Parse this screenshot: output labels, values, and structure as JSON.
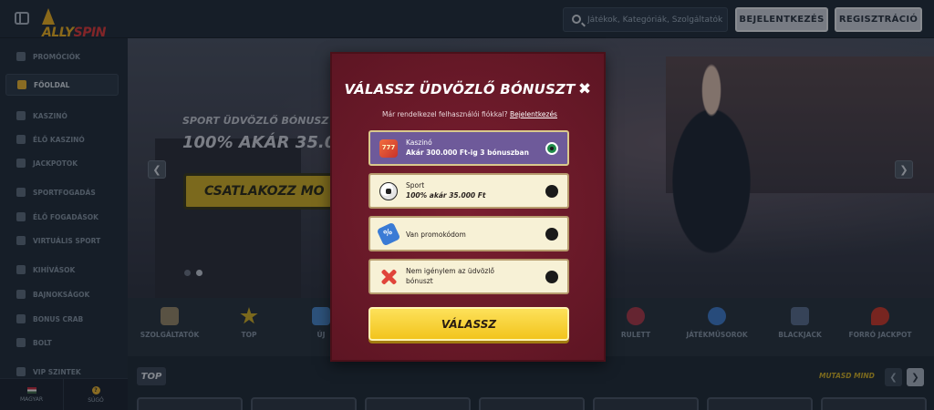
{
  "header": {
    "logo_text_a": "ALLY",
    "logo_text_b": "SPIN",
    "search_placeholder": "Játékok, Kategóriák, Szolgáltatók",
    "login_label": "Bejelentkezés",
    "register_label": "Regisztráció"
  },
  "sidebar": {
    "items": [
      {
        "label": "Promóciók",
        "icon": "gift-icon"
      },
      {
        "label": "Főoldal",
        "icon": "home-icon",
        "active": true
      },
      {
        "label": "Kaszinó",
        "icon": "cards-icon"
      },
      {
        "label": "Élő kaszinó",
        "icon": "live-icon"
      },
      {
        "label": "Jackpotok",
        "icon": "clover-icon"
      },
      {
        "label": "Sportfogadás",
        "icon": "ball-icon"
      },
      {
        "label": "Élő fogadások",
        "icon": "tv-icon"
      },
      {
        "label": "Virtuális sport",
        "icon": "vr-icon"
      },
      {
        "label": "Kihívások",
        "icon": "medal-icon"
      },
      {
        "label": "Bajnokságok",
        "icon": "trophy-icon"
      },
      {
        "label": "Bonus Crab",
        "icon": "crab-icon"
      },
      {
        "label": "Bolt",
        "icon": "cart-icon"
      },
      {
        "label": "VIP Szintek",
        "icon": "diamond-icon"
      }
    ],
    "footer": {
      "language": "Magyar",
      "help": "Súgó"
    }
  },
  "hero": {
    "subtitle": "Sport üdvözlő bónusz",
    "title": "100% akár 35.00",
    "cta": "Csatlakozz mo"
  },
  "categories": [
    {
      "label": "Szolgáltatók",
      "icon": "providers-icon",
      "color": "#9a8a6a"
    },
    {
      "label": "Top",
      "icon": "star-icon",
      "color": "#d7b525"
    },
    {
      "label": "Új",
      "icon": "new-icon",
      "color": "#4a8ad0"
    },
    {
      "label": "Rulett",
      "icon": "roulette-icon",
      "color": "#b03a4a"
    },
    {
      "label": "Játékműsorok",
      "icon": "gameshow-icon",
      "color": "#3f7fd0"
    },
    {
      "label": "Blackjack",
      "icon": "blackjack-icon",
      "color": "#5a6f90"
    },
    {
      "label": "Forró jackpot",
      "icon": "chili-icon",
      "color": "#d03a2a"
    }
  ],
  "top_section": {
    "tag": "TOP",
    "show_all": "Mutasd mind"
  },
  "modal": {
    "title": "Válassz üdvözlő bónuszt",
    "subtitle_prefix": "Már rendelkezel felhasználói fiókkal?",
    "subtitle_link": "Bejelentkezés",
    "options": [
      {
        "line1": "Kaszinó",
        "line2": "Akár 300.000 Ft-ig 3 bónuszban",
        "icon": "slot-machine-icon",
        "selected": true
      },
      {
        "line1": "Sport",
        "line2": "100% akár 35.000 Ft",
        "icon": "soccer-ball-icon",
        "selected": false
      },
      {
        "line1": "Van promokódom",
        "line2": "",
        "icon": "promo-ticket-icon",
        "selected": false
      },
      {
        "line1": "Nem igénylem az üdvözlő bónuszt",
        "line2": "",
        "icon": "decline-x-icon",
        "selected": false
      }
    ],
    "choose_label": "Válassz"
  },
  "colors": {
    "modal_bg": "#6b1a2a",
    "selected_option": "#6e5a9a",
    "accent_yellow": "#f2c41d"
  }
}
